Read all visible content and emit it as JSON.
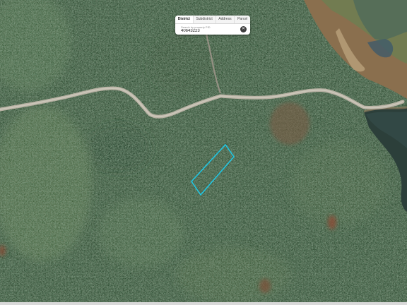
{
  "search_panel": {
    "tabs": [
      "District",
      "Subdistrict",
      "Address",
      "Parcel"
    ],
    "active_tab_index": 0,
    "placeholder": "Search by property PID",
    "value": "40643223",
    "clear_icon": "close-icon"
  },
  "map": {
    "parcel_outline_color": "#1ec8e6",
    "road_color": "#b8b2a4",
    "map_type": "satellite"
  }
}
